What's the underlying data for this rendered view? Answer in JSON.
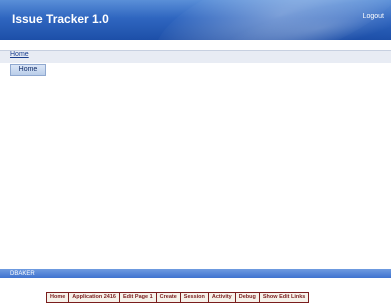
{
  "header": {
    "title": "Issue Tracker 1.0",
    "logout_label": "Logout"
  },
  "breadcrumb": {
    "current": "Home"
  },
  "tabs": [
    {
      "label": "Home"
    }
  ],
  "footer": {
    "user": "DBAKER"
  },
  "developer_toolbar": {
    "items": [
      "Home",
      "Application 2416",
      "Edit Page 1",
      "Create",
      "Session",
      "Activity",
      "Debug",
      "Show Edit Links"
    ]
  },
  "colors": {
    "header_blue": "#2f66c0",
    "toolbar_text": "#7a1d1d"
  }
}
